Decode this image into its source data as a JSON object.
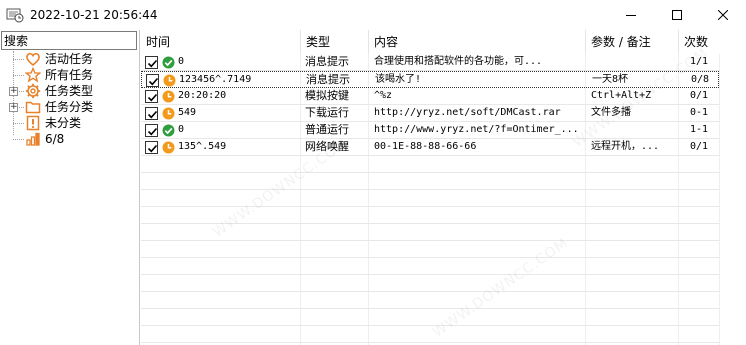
{
  "window": {
    "title": "2022-10-21 20:56:44",
    "controls": {
      "minimize": "minimize",
      "maximize": "maximize",
      "close": "close"
    }
  },
  "sidebar": {
    "search_value": "搜索",
    "items": [
      {
        "label": "活动任务",
        "icon": "heart-icon"
      },
      {
        "label": "所有任务",
        "icon": "star-icon"
      },
      {
        "label": "任务类型",
        "icon": "gear-icon",
        "expandable": true
      },
      {
        "label": "任务分类",
        "icon": "folder-icon",
        "expandable": true
      },
      {
        "label": "未分类",
        "icon": "exclamation-icon"
      },
      {
        "label": "6/8",
        "icon": "bar-chart-icon"
      }
    ]
  },
  "grid": {
    "columns": [
      "时间",
      "类型",
      "内容",
      "参数 / 备注",
      "次数"
    ],
    "rows": [
      {
        "checked": true,
        "status": "check",
        "time": "0",
        "type": "消息提示",
        "content": "合理使用和搭配软件的各功能，可...",
        "params": "",
        "count": "1/1"
      },
      {
        "checked": true,
        "status": "clock",
        "time": "123456^.7149",
        "type": "消息提示",
        "content": "该喝水了!",
        "params": "一天8杯",
        "count": "0/8",
        "selected": true
      },
      {
        "checked": true,
        "status": "clock",
        "time": "20:20:20",
        "type": "模拟按键",
        "content": "^%z",
        "params": "Ctrl+Alt+Z",
        "count": "0/1"
      },
      {
        "checked": true,
        "status": "clock",
        "time": "549",
        "type": "下载运行",
        "content": "http://yryz.net/soft/DMCast.rar",
        "params": "文件多播",
        "count": "0-1"
      },
      {
        "checked": true,
        "status": "check",
        "time": "0",
        "type": "普通运行",
        "content": "http://www.yryz.net/?f=Ontimer_...",
        "params": "",
        "count": "1-1"
      },
      {
        "checked": true,
        "status": "clock",
        "time": "135^.549",
        "type": "网络唤醒",
        "content": "00-1E-88-88-66-66",
        "params": "远程开机，...",
        "count": "0/1"
      }
    ]
  },
  "colors": {
    "check_green": "#2e9e3e",
    "clock_orange": "#f39a1c",
    "icon_orange": "#e8822a"
  }
}
